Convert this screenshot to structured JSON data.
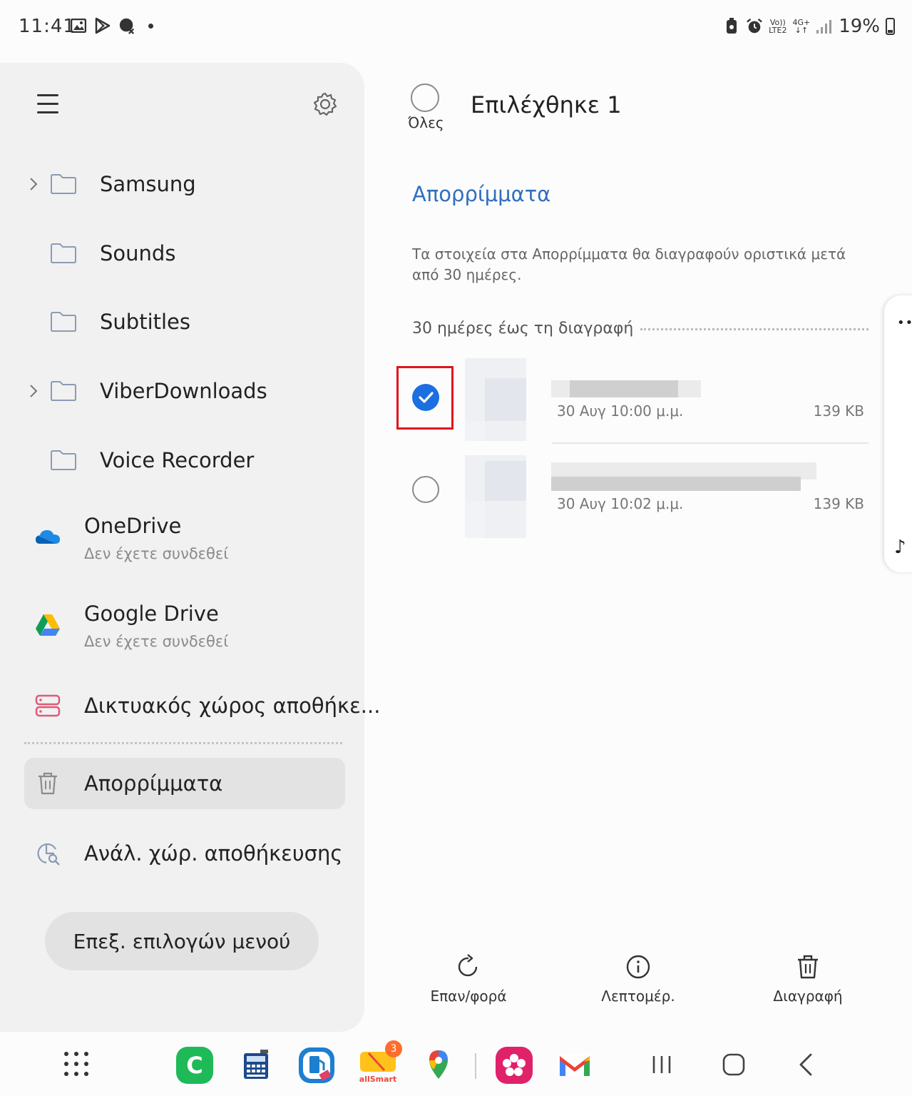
{
  "status_bar": {
    "time": "11:41",
    "network_top": "Vo))",
    "network_bottom": "LTE2",
    "data_type": "4G+",
    "battery": "19%"
  },
  "drawer": {
    "folders": [
      {
        "label": "Samsung",
        "expandable": true
      },
      {
        "label": "Sounds",
        "expandable": false
      },
      {
        "label": "Subtitles",
        "expandable": false
      },
      {
        "label": "ViberDownloads",
        "expandable": true
      },
      {
        "label": "Voice Recorder",
        "expandable": false
      }
    ],
    "clouds": [
      {
        "title": "OneDrive",
        "subtitle": "Δεν έχετε συνδεθεί"
      },
      {
        "title": "Google Drive",
        "subtitle": "Δεν έχετε συνδεθεί"
      }
    ],
    "network_storage": "Δικτυακός χώρος αποθήκε...",
    "trash": "Απορρίμματα",
    "storage_analysis": "Ανάλ. χώρ. αποθήκευσης",
    "menu_button": "Επεξ. επιλογών μενού"
  },
  "content": {
    "select_all_label": "Όλες",
    "selected_title": "Επιλέχθηκε 1",
    "section_title": "Απορρίμματα",
    "notice": "Τα στοιχεία στα Απορρίμματα θα διαγραφούν οριστικά μετά από 30 ημέρες.",
    "group_header": "30 ημέρες έως τη διαγραφή",
    "files": [
      {
        "date": "30 Αυγ 10:00 μ.μ.",
        "size": "139 KB",
        "selected": true
      },
      {
        "date": "30 Αυγ 10:02 μ.μ.",
        "size": "139 KB",
        "selected": false
      }
    ]
  },
  "actions": {
    "restore": "Επαν/φορά",
    "details": "Λεπτομέρ.",
    "delete": "Διαγραφή"
  },
  "taskbar": {
    "badge_count": "3",
    "allsmart_label": "allSmart"
  },
  "colors": {
    "accent": "#1b6fe0",
    "section_title": "#2f6fc0",
    "highlight": "#e0141e",
    "drawer_bg": "#f1f1f1"
  }
}
